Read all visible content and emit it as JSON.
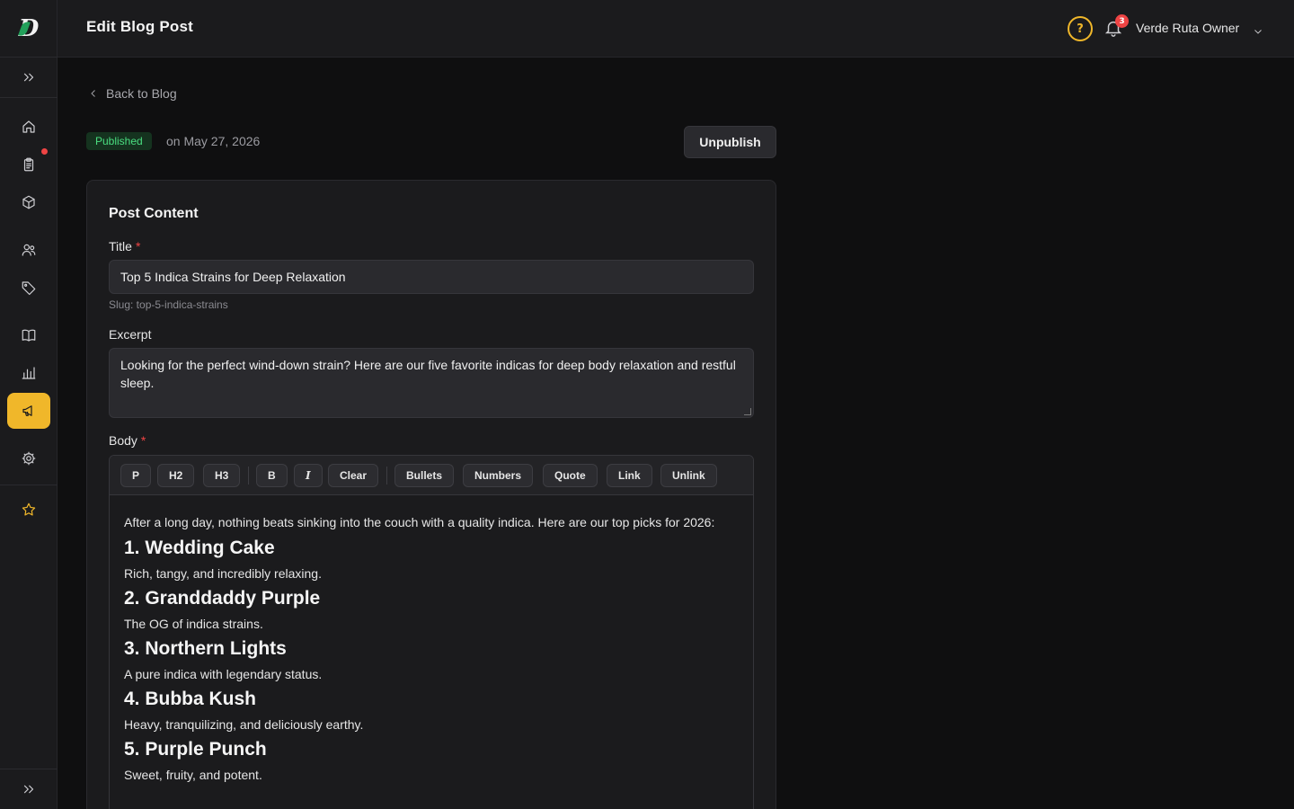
{
  "header": {
    "title": "Edit Blog Post",
    "help_symbol": "?",
    "notification_count": "3",
    "user_name": "Verde Ruta Owner"
  },
  "sidebar": {
    "items": [
      {
        "name": "home",
        "icon": "home-icon"
      },
      {
        "name": "orders",
        "icon": "clipboard-icon",
        "has_dot": true
      },
      {
        "name": "products",
        "icon": "box-icon"
      },
      {
        "name": "customers",
        "icon": "users-icon"
      },
      {
        "name": "promotions",
        "icon": "tag-icon"
      },
      {
        "name": "content",
        "icon": "book-icon"
      },
      {
        "name": "analytics",
        "icon": "bar-chart-icon"
      },
      {
        "name": "marketing",
        "icon": "megaphone-icon",
        "active": true
      },
      {
        "name": "settings",
        "icon": "gear-icon"
      },
      {
        "name": "favorites",
        "icon": "star-icon"
      }
    ],
    "accent_color": "#f0b72a"
  },
  "main": {
    "back_label": "Back to Blog",
    "status_badge": "Published",
    "published_date": "on May 27, 2026",
    "unpublish_label": "Unpublish"
  },
  "form": {
    "section_title": "Post Content",
    "title_label": "Title",
    "title_value": "Top 5 Indica Strains for Deep Relaxation",
    "slug": "Slug: top-5-indica-strains",
    "excerpt_label": "Excerpt",
    "excerpt_value": "Looking for the perfect wind-down strain? Here are our five favorite indicas for deep body relaxation and restful sleep.",
    "body_label": "Body",
    "required_mark": "*"
  },
  "toolbar": {
    "buttons": [
      "P",
      "H2",
      "H3",
      "B",
      "I",
      "Clear",
      "Bullets",
      "Numbers",
      "Quote",
      "Link",
      "Unlink"
    ]
  },
  "body": {
    "intro": "After a long day, nothing beats sinking into the couch with a quality indica. Here are our top picks for 2026:",
    "sections": [
      {
        "heading": "1. Wedding Cake",
        "text": "Rich, tangy, and incredibly relaxing."
      },
      {
        "heading": "2. Granddaddy Purple",
        "text": "The OG of indica strains."
      },
      {
        "heading": "3. Northern Lights",
        "text": "A pure indica with legendary status."
      },
      {
        "heading": "4. Bubba Kush",
        "text": "Heavy, tranquilizing, and deliciously earthy."
      },
      {
        "heading": "5. Purple Punch",
        "text": "Sweet, fruity, and potent."
      }
    ]
  }
}
